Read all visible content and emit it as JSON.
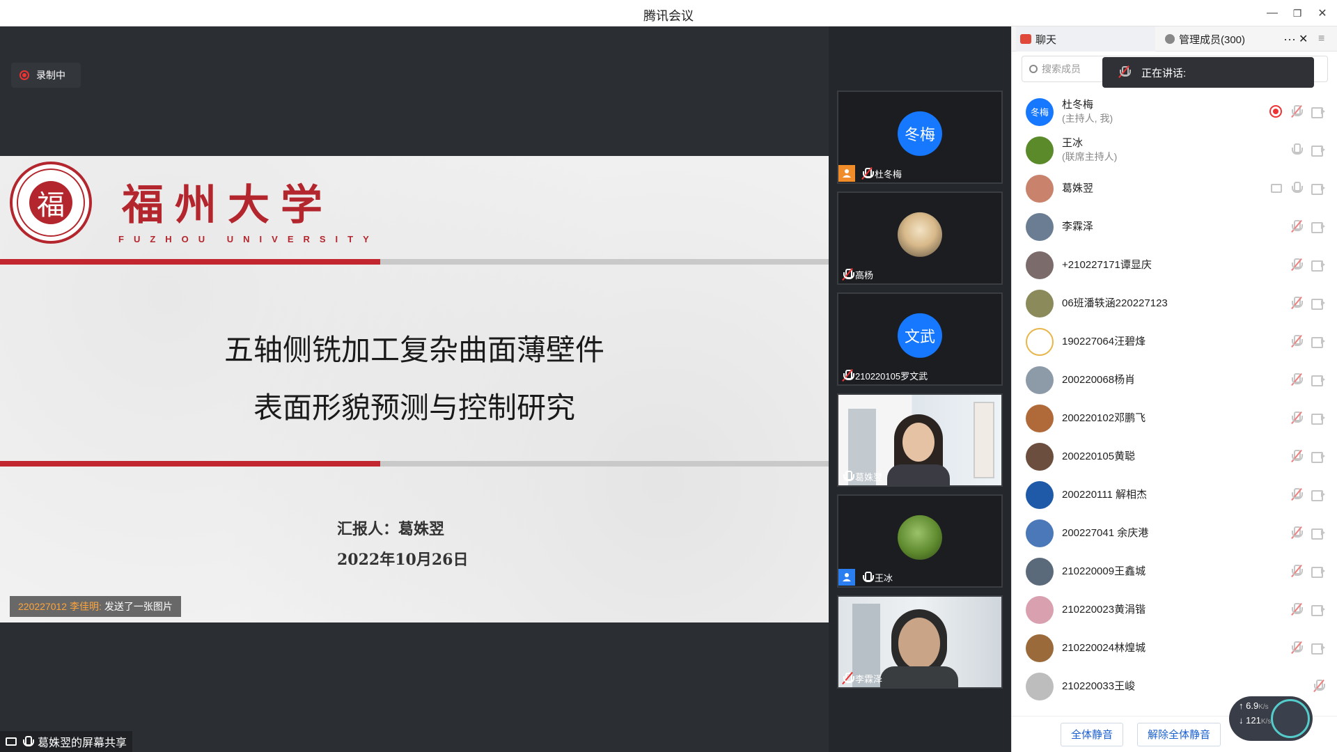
{
  "window": {
    "title": "腾讯会议"
  },
  "recording": {
    "label": "录制中"
  },
  "slide": {
    "university_cn": "福州大学",
    "university_en": "FUZHOU UNIVERSITY",
    "seal_char": "福",
    "title_line1": "五轴侧铣加工复杂曲面薄壁件",
    "title_line2": "表面形貌预测与控制研究",
    "reporter": "汇报人：葛姝翌",
    "date": "2022年10月26日"
  },
  "notice": {
    "who": "220227012 李佳明:",
    "text": "发送了一张图片"
  },
  "share_label": "葛姝翌的屏幕共享",
  "gallery": [
    {
      "name": "杜冬梅",
      "avatar_text": "冬梅",
      "badge": "host",
      "muted": true
    },
    {
      "name": "高杨",
      "avatar_text": "",
      "badge": "",
      "muted": true
    },
    {
      "name": "210220105罗文武",
      "avatar_text": "文武",
      "badge": "",
      "muted": true
    },
    {
      "name": "葛姝翌",
      "avatar_text": "",
      "badge": "",
      "muted": false,
      "video": true
    },
    {
      "name": "王冰",
      "avatar_text": "",
      "badge": "cohost",
      "muted": false
    },
    {
      "name": "李霖泽",
      "avatar_text": "",
      "badge": "",
      "muted": true,
      "video": true
    }
  ],
  "panel": {
    "tab_chat": "聊天",
    "tab_members": "管理成员(300)",
    "search_placeholder": "搜索成员",
    "speaking_label": "正在讲话:",
    "mute_all": "全体静音",
    "unmute_all": "解除全体静音"
  },
  "members": [
    {
      "name": "杜冬梅",
      "role": "(主持人, 我)",
      "avatar": "冬梅",
      "color": "#2a7ef0"
    },
    {
      "name": "王冰",
      "role": "(联席主持人)",
      "avatar": "",
      "color": "#5a8a2a"
    },
    {
      "name": "葛姝翌",
      "role": "",
      "avatar": "",
      "color": "#c9826b"
    },
    {
      "name": "李霖泽",
      "role": "",
      "avatar": "",
      "color": "#6a7d93"
    },
    {
      "name": "+210227171谭显庆",
      "role": "",
      "avatar": "",
      "color": "#7b6b6b"
    },
    {
      "name": "06班潘轶涵220227123",
      "role": "",
      "avatar": "",
      "color": "#8a8a5a"
    },
    {
      "name": "190227064汪碧烽",
      "role": "",
      "avatar": "",
      "color": "#e8b54a"
    },
    {
      "name": "200220068杨肖",
      "role": "",
      "avatar": "",
      "color": "#8d9aa8"
    },
    {
      "name": "200220102邓鹏飞",
      "role": "",
      "avatar": "",
      "color": "#b06a3a"
    },
    {
      "name": "200220105黄聪",
      "role": "",
      "avatar": "",
      "color": "#6b4e3d"
    },
    {
      "name": "200220111 解相杰",
      "role": "",
      "avatar": "",
      "color": "#1e5aa8"
    },
    {
      "name": "200227041 余庆港",
      "role": "",
      "avatar": "",
      "color": "#4a78b8"
    },
    {
      "name": "210220009王鑫城",
      "role": "",
      "avatar": "",
      "color": "#5a6a7a"
    },
    {
      "name": "210220023黄涓锴",
      "role": "",
      "avatar": "",
      "color": "#d9a0b0"
    },
    {
      "name": "210220024林煌城",
      "role": "",
      "avatar": "",
      "color": "#9a6a3a"
    },
    {
      "name": "210220033王峻",
      "role": "",
      "avatar": "",
      "color": "#bdbdbd"
    }
  ],
  "network": {
    "up": "6.9",
    "down": "121",
    "unit": "K/s"
  }
}
